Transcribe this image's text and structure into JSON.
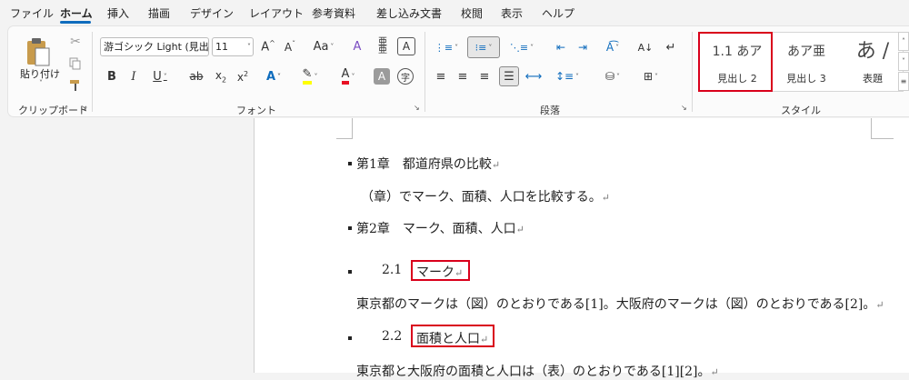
{
  "menu": [
    "ファイル",
    "ホーム",
    "挿入",
    "描画",
    "デザイン",
    "レイアウト",
    "参考資料",
    "差し込み文書",
    "校閲",
    "表示",
    "ヘルプ"
  ],
  "clipboard": {
    "paste_label": "貼り付け",
    "group_label": "クリップボード"
  },
  "font": {
    "name": "游ゴシック Light (見出",
    "size": "11",
    "group_label": "フォント",
    "aa_label": "Aa"
  },
  "paragraph": {
    "group_label": "段落"
  },
  "styles": {
    "group_label": "スタイル",
    "items": [
      {
        "preview": "1.1 あア",
        "name": "見出し 2"
      },
      {
        "preview": "あア亜",
        "name": "見出し 3"
      },
      {
        "preview": "あ /",
        "name": "表題"
      }
    ]
  },
  "document": {
    "ch1_heading": "第1章　都道府県の比較",
    "ch1_body": "（章）でマーク、面積、人口を比較する。",
    "ch2_heading": "第2章　マーク、面積、人口",
    "sec21_number": "2.1",
    "sec21_title": "マーク",
    "sec21_body": "東京都のマークは（図）のとおりである[1]。大阪府のマークは（図）のとおりである[2]。",
    "sec22_number": "2.2",
    "sec22_title": "面積と人口",
    "sec22_body": "東京都と大阪府の面積と人口は（表）のとおりである[1][2]。",
    "paragraph_mark": "↵"
  },
  "colors": {
    "accent": "#0f6cbd",
    "highlight_box": "#d9001b",
    "highlighter": "#ffff00",
    "font_color": "#e81123"
  }
}
